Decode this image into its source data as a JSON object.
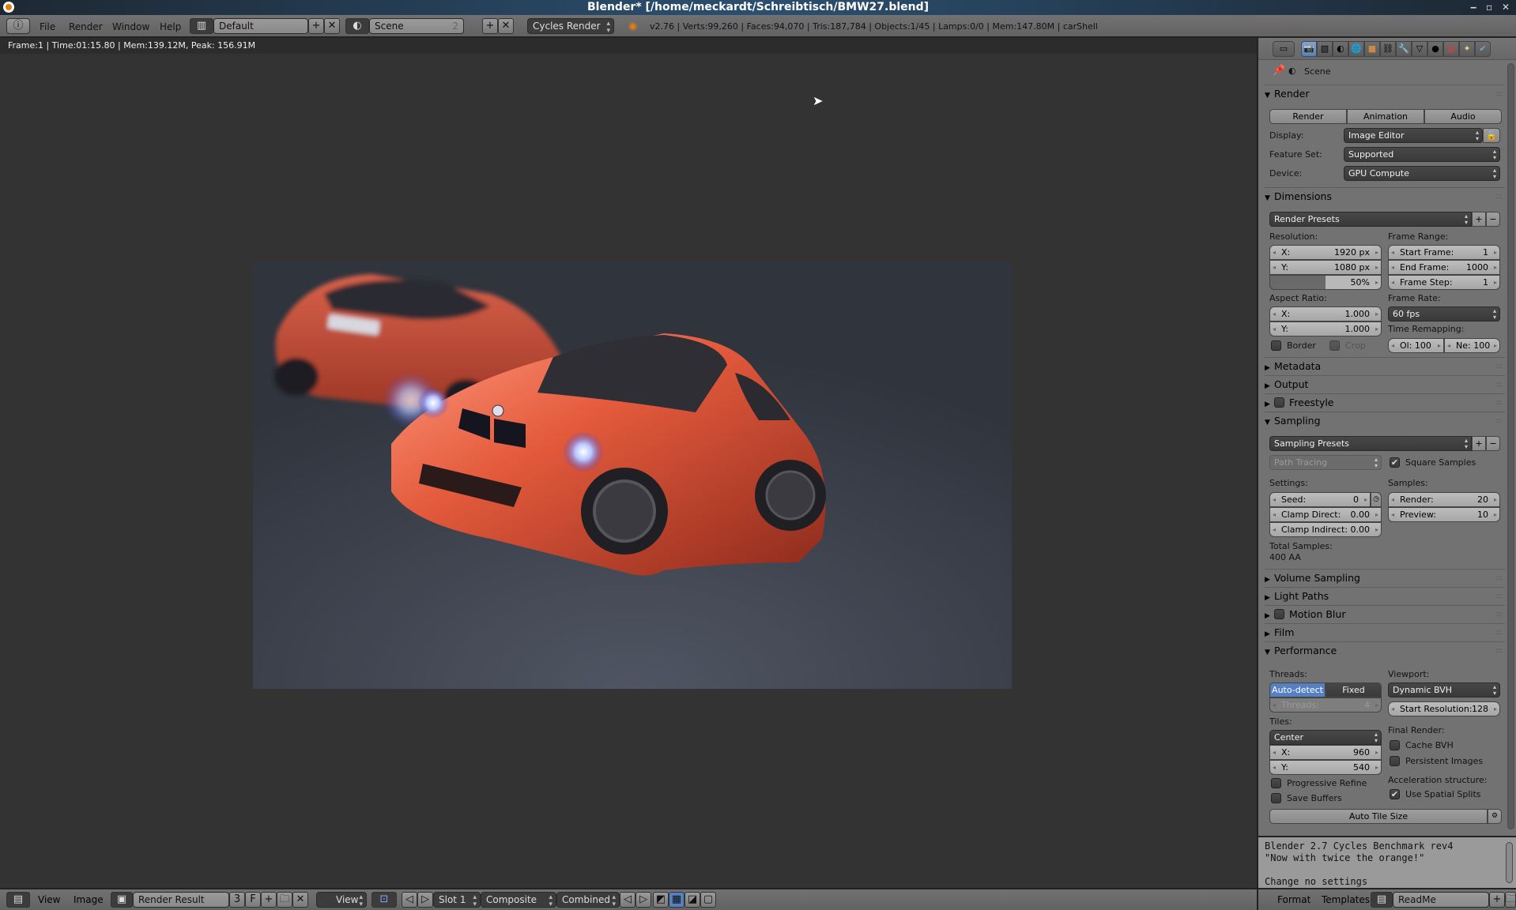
{
  "window": {
    "title": "Blender* [/home/meckardt/Schreibtisch/BMW27.blend]",
    "controls": [
      "minimize",
      "maximize",
      "close"
    ]
  },
  "top_header": {
    "menus": [
      "File",
      "Render",
      "Window",
      "Help"
    ],
    "layout": "Default",
    "scene": "Scene",
    "scene_users": "2",
    "engine": "Cycles Render",
    "stats": "v2.76 | Verts:99,260 | Faces:94,070 | Tris:187,784 | Objects:1/45 | Lamps:0/0 | Mem:147.80M | carShell"
  },
  "image_editor": {
    "info": "Frame:1 | Time:01:15.80 | Mem:139.12M, Peak: 156.91M",
    "render_description": "Two orange BMW 1M coupes on dark grey studio floor, front car with glowing headlights"
  },
  "bottom_header": {
    "menus": [
      "View",
      "Image"
    ],
    "image_name": "Render Result",
    "image_users": "3",
    "fake_user": "F",
    "view_mode": "View",
    "slot": "Slot 1",
    "layer": "Composite",
    "pass": "Combined"
  },
  "properties": {
    "context_path": "Scene",
    "tabs": [
      "render",
      "render-layers",
      "scene",
      "world",
      "object",
      "constraints",
      "modifiers",
      "data",
      "material",
      "texture",
      "particles",
      "physics"
    ],
    "render": {
      "header": "Render",
      "buttons": [
        "Render",
        "Animation",
        "Audio"
      ],
      "display_label": "Display:",
      "display_value": "Image Editor",
      "feature_set_label": "Feature Set:",
      "feature_set_value": "Supported",
      "device_label": "Device:",
      "device_value": "GPU Compute"
    },
    "dimensions": {
      "header": "Dimensions",
      "presets": "Render Presets",
      "resolution_label": "Resolution:",
      "res_x_label": "X:",
      "res_x": "1920 px",
      "res_y_label": "Y:",
      "res_y": "1080 px",
      "res_percent": "50%",
      "res_percent_value": 0.5,
      "frame_range_label": "Frame Range:",
      "start_frame_label": "Start Frame:",
      "start_frame": "1",
      "end_frame_label": "End Frame:",
      "end_frame": "1000",
      "frame_step_label": "Frame Step:",
      "frame_step": "1",
      "aspect_label": "Aspect Ratio:",
      "aspect_x_label": "X:",
      "aspect_x": "1.000",
      "aspect_y_label": "Y:",
      "aspect_y": "1.000",
      "frame_rate_label": "Frame Rate:",
      "frame_rate": "60 fps",
      "time_remap_label": "Time Remapping:",
      "old": "Ol: 100",
      "new": "Ne: 100",
      "border_label": "Border",
      "border_checked": false,
      "crop_label": "Crop",
      "crop_checked": false
    },
    "collapsed_panels_1": [
      "Metadata",
      "Output"
    ],
    "freestyle": {
      "label": "Freestyle",
      "checked": false
    },
    "sampling": {
      "header": "Sampling",
      "presets": "Sampling Presets",
      "integrator": "Path Tracing",
      "square_samples_label": "Square Samples",
      "square_samples": true,
      "settings_label": "Settings:",
      "seed_label": "Seed:",
      "seed": "0",
      "clamp_direct_label": "Clamp Direct:",
      "clamp_direct": "0.00",
      "clamp_indirect_label": "Clamp Indirect:",
      "clamp_indirect": "0.00",
      "samples_label": "Samples:",
      "render_label": "Render:",
      "render": "20",
      "preview_label": "Preview:",
      "preview": "10",
      "total_label": "Total Samples:",
      "total": "400 AA"
    },
    "collapsed_panels_2": [
      "Volume Sampling",
      "Light Paths"
    ],
    "motion_blur": {
      "label": "Motion Blur",
      "checked": false
    },
    "film": "Film",
    "performance": {
      "header": "Performance",
      "threads_label": "Threads:",
      "auto_detect": "Auto-detect",
      "fixed": "Fixed",
      "threads_field_label": "Threads:",
      "threads": "4",
      "tiles_label": "Tiles:",
      "tile_order": "Center",
      "tile_x_label": "X:",
      "tile_x": "960",
      "tile_y_label": "Y:",
      "tile_y": "540",
      "progressive_refine": "Progressive Refine",
      "save_buffers": "Save Buffers",
      "viewport_label": "Viewport:",
      "viewport_bvh": "Dynamic BVH",
      "start_res_label": "Start Resolution:",
      "start_res": "128",
      "final_render_label": "Final Render:",
      "cache_bvh": "Cache BVH",
      "persistent_images": "Persistent Images",
      "accel_label": "Acceleration structure:",
      "spatial_splits": "Use Spatial Splits",
      "spatial_splits_checked": true,
      "auto_tile_size": "Auto Tile Size"
    }
  },
  "text_editor": {
    "lines": [
      "Blender 2.7 Cycles Benchmark rev4",
      "\"Now with twice the orange!\"",
      "",
      "Change no settings"
    ],
    "menus": [
      "Format",
      "Templates"
    ],
    "text_name": "ReadMe"
  },
  "colors": {
    "accent": "#5680c2",
    "car_orange": "#e0583a",
    "header_bg": "#6e6e6e",
    "panel_bg": "#727272"
  }
}
